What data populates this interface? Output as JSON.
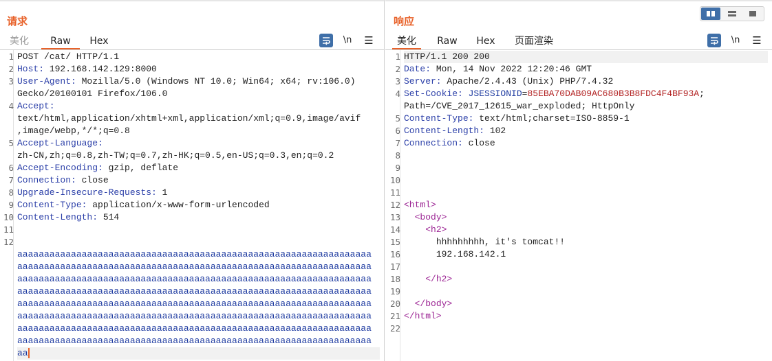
{
  "request": {
    "title": "请求",
    "tabs": [
      "美化",
      "Raw",
      "Hex"
    ],
    "active_tab": "Raw",
    "newline_label": "\\n",
    "lines": [
      {
        "n": "1",
        "key": "",
        "val": "POST /cat/ HTTP/1.1"
      },
      {
        "n": "2",
        "key": "Host:",
        "val": " 192.168.142.129:8000"
      },
      {
        "n": "3",
        "key": "User-Agent:",
        "val": " Mozilla/5.0 (Windows NT 10.0; Win64; x64; rv:106.0)"
      },
      {
        "n": "",
        "key": "",
        "val": "Gecko/20100101 Firefox/106.0"
      },
      {
        "n": "4",
        "key": "Accept:",
        "val": ""
      },
      {
        "n": "",
        "key": "",
        "val": "text/html,application/xhtml+xml,application/xml;q=0.9,image/avif"
      },
      {
        "n": "",
        "key": "",
        "val": ",image/webp,*/*;q=0.8"
      },
      {
        "n": "5",
        "key": "Accept-Language:",
        "val": ""
      },
      {
        "n": "",
        "key": "",
        "val": "zh-CN,zh;q=0.8,zh-TW;q=0.7,zh-HK;q=0.5,en-US;q=0.3,en;q=0.2"
      },
      {
        "n": "6",
        "key": "Accept-Encoding:",
        "val": " gzip, deflate"
      },
      {
        "n": "7",
        "key": "Connection:",
        "val": " close"
      },
      {
        "n": "8",
        "key": "Upgrade-Insecure-Requests:",
        "val": " 1"
      },
      {
        "n": "9",
        "key": "Content-Type:",
        "val": " application/x-www-form-urlencoded"
      },
      {
        "n": "10",
        "key": "Content-Length:",
        "val": " 514"
      },
      {
        "n": "11",
        "key": "",
        "val": ""
      },
      {
        "n": "12",
        "key": "",
        "val": ""
      },
      {
        "n": "",
        "aaa": "aaaaaaaaaaaaaaaaaaaaaaaaaaaaaaaaaaaaaaaaaaaaaaaaaaaaaaaaaaaaaaaaaa"
      },
      {
        "n": "",
        "aaa": "aaaaaaaaaaaaaaaaaaaaaaaaaaaaaaaaaaaaaaaaaaaaaaaaaaaaaaaaaaaaaaaaaa"
      },
      {
        "n": "",
        "aaa": "aaaaaaaaaaaaaaaaaaaaaaaaaaaaaaaaaaaaaaaaaaaaaaaaaaaaaaaaaaaaaaaaaa"
      },
      {
        "n": "",
        "aaa": "aaaaaaaaaaaaaaaaaaaaaaaaaaaaaaaaaaaaaaaaaaaaaaaaaaaaaaaaaaaaaaaaaa"
      },
      {
        "n": "",
        "aaa": "aaaaaaaaaaaaaaaaaaaaaaaaaaaaaaaaaaaaaaaaaaaaaaaaaaaaaaaaaaaaaaaaaa"
      },
      {
        "n": "",
        "aaa": "aaaaaaaaaaaaaaaaaaaaaaaaaaaaaaaaaaaaaaaaaaaaaaaaaaaaaaaaaaaaaaaaaa"
      },
      {
        "n": "",
        "aaa": "aaaaaaaaaaaaaaaaaaaaaaaaaaaaaaaaaaaaaaaaaaaaaaaaaaaaaaaaaaaaaaaaaa"
      },
      {
        "n": "",
        "aaa": "aaaaaaaaaaaaaaaaaaaaaaaaaaaaaaaaaaaaaaaaaaaaaaaaaaaaaaaaaaaaaaaaaa"
      },
      {
        "n": "",
        "aaa": "aa",
        "cursor": true
      }
    ]
  },
  "response": {
    "title": "响应",
    "tabs": [
      "美化",
      "Raw",
      "Hex",
      "页面渲染"
    ],
    "active_tab": "美化",
    "newline_label": "\\n",
    "lines": [
      {
        "n": "1",
        "key": "",
        "val": "HTTP/1.1 200 200"
      },
      {
        "n": "2",
        "key": "Date:",
        "val": " Mon, 14 Nov 2022 12:20:46 GMT"
      },
      {
        "n": "3",
        "key": "Server:",
        "val": " Apache/2.4.43 (Unix) PHP/7.4.32"
      },
      {
        "n": "4",
        "key": "Set-Cookie:",
        "cookie_name": " JSESSIONID",
        "cookie_eq": "=",
        "cookie_val": "85EBA70DAB09AC680B3B8FDC4F4BF93A",
        "val": ";"
      },
      {
        "n": "",
        "key": "",
        "val": "Path=/CVE_2017_12615_war_exploded; HttpOnly"
      },
      {
        "n": "5",
        "key": "Content-Type:",
        "val": " text/html;charset=ISO-8859-1"
      },
      {
        "n": "6",
        "key": "Content-Length:",
        "val": " 102"
      },
      {
        "n": "7",
        "key": "Connection:",
        "val": " close"
      },
      {
        "n": "8",
        "key": "",
        "val": ""
      },
      {
        "n": "9",
        "key": "",
        "val": ""
      },
      {
        "n": "10",
        "key": "",
        "val": ""
      },
      {
        "n": "11",
        "key": "",
        "val": ""
      },
      {
        "n": "12",
        "tag": "<html>",
        "indent": ""
      },
      {
        "n": "13",
        "tag": "<body>",
        "indent": "  "
      },
      {
        "n": "14",
        "tag": "<h2>",
        "indent": "    "
      },
      {
        "n": "15",
        "text": "hhhhhhhhh, it's tomcat!!",
        "indent": "      "
      },
      {
        "n": "16",
        "text": "192.168.142.1",
        "indent": "      "
      },
      {
        "n": "17",
        "key": "",
        "val": ""
      },
      {
        "n": "18",
        "tag": "</h2>",
        "indent": "    "
      },
      {
        "n": "19",
        "key": "",
        "val": ""
      },
      {
        "n": "20",
        "tag": "</body>",
        "indent": "  "
      },
      {
        "n": "21",
        "tag": "</html>",
        "indent": ""
      },
      {
        "n": "22",
        "key": "",
        "val": ""
      }
    ]
  },
  "colors": {
    "accent": "#e8622a",
    "key": "#2b3fa8",
    "cookie_val": "#b22222",
    "tag": "#9b2393",
    "toolbar_blue": "#3f6fa8"
  },
  "icons": {
    "wrap": "wrap-lines-icon",
    "menu": "hamburger-menu-icon",
    "layout": [
      "side-by-side-layout-icon",
      "stacked-layout-icon",
      "single-layout-icon"
    ]
  }
}
